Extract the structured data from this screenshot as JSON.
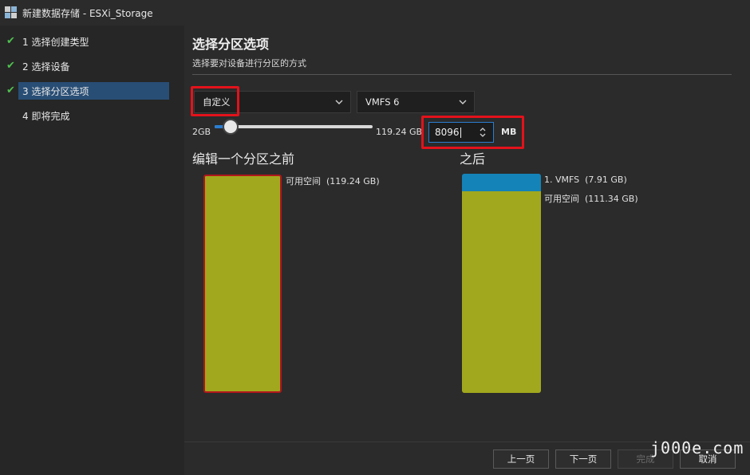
{
  "window": {
    "title": "新建数据存储 - ESXi_Storage"
  },
  "steps": [
    {
      "label": "1 选择创建类型",
      "done": true
    },
    {
      "label": "2 选择设备",
      "done": true
    },
    {
      "label": "3 选择分区选项",
      "done": true
    },
    {
      "label": "4 即将完成",
      "done": false
    }
  ],
  "header": {
    "title": "选择分区选项",
    "subtitle": "选择要对设备进行分区的方式"
  },
  "partition_mode": {
    "selected": "自定义"
  },
  "fs_type": {
    "selected": "VMFS 6"
  },
  "size_slider": {
    "min_label": "2GB",
    "max_label": "119.24 GB",
    "value_fraction": 0.1
  },
  "size_input": {
    "value": "8096",
    "unit": "MB"
  },
  "before": {
    "heading": "编辑一个分区之前",
    "free_label": "可用空间",
    "free_size": "(119.24 GB)"
  },
  "after": {
    "heading": "之后",
    "vmfs_label": "1. VMFS",
    "vmfs_size": "(7.91 GB)",
    "free_label": "可用空间",
    "free_size": "(111.34 GB)",
    "vmfs_fraction": 0.066
  },
  "colors": {
    "free": "#a2a81d",
    "vmfs": "#1483b8",
    "accent": "#2a7dd1",
    "highlight": "#e3121b"
  },
  "buttons": {
    "back": "上一页",
    "next": "下一页",
    "finish": "完成",
    "cancel": "取消"
  },
  "watermark": "j000e.com"
}
